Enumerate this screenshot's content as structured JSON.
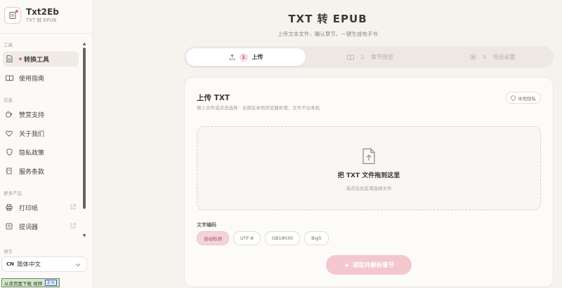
{
  "brand": {
    "title": "Txt2Eb",
    "subtitle": "TXT 转 EPUB"
  },
  "sidebar": {
    "sections": [
      {
        "label": "工具",
        "items": [
          {
            "label": "转换工具",
            "icon": "document-icon",
            "active": true
          },
          {
            "label": "使用指南",
            "icon": "book-icon"
          }
        ]
      },
      {
        "label": "信息",
        "items": [
          {
            "label": "赞赏支持",
            "icon": "cup-icon"
          },
          {
            "label": "关于我们",
            "icon": "heart-icon"
          },
          {
            "label": "隐私政策",
            "icon": "shield-icon"
          },
          {
            "label": "服务条款",
            "icon": "terms-icon"
          }
        ]
      },
      {
        "label": "更多产品",
        "items": [
          {
            "label": "打印纸",
            "icon": "printer-icon"
          },
          {
            "label": "提词器",
            "icon": "teleprompter-icon"
          }
        ]
      }
    ],
    "language": {
      "label": "语言",
      "code": "CN",
      "value": "简体中文"
    }
  },
  "taskbar": {
    "text": "从该页面下载 视频",
    "button": "2 ×"
  },
  "header": {
    "title": "TXT 转 EPUB",
    "subtitle": "上传文本文件，确认章节，一键生成电子书"
  },
  "steps": [
    {
      "number": "1",
      "label": "上传",
      "active": true
    },
    {
      "number": "2",
      "label": "章节预览"
    },
    {
      "number": "3",
      "label": "导出设置"
    }
  ],
  "upload": {
    "title": "上传 TXT",
    "description": "拖入文件或点击选择 · 全部在本地浏览器处理，文件不出本机",
    "badge": "本地隐私",
    "dropzone_title": "把 TXT 文件拖到这里",
    "dropzone_hint": "或点击此区域选择文件",
    "encoding_label": "文字编码",
    "encodings": [
      "自动检测",
      "UTF-8",
      "GB18030",
      "Big5"
    ],
    "selected_encoding": "自动检测",
    "submit": "读取并解析章节"
  },
  "colors": {
    "accent": "#e0697d",
    "accent_soft": "#f4d4da",
    "background": "#f6f3ef"
  }
}
